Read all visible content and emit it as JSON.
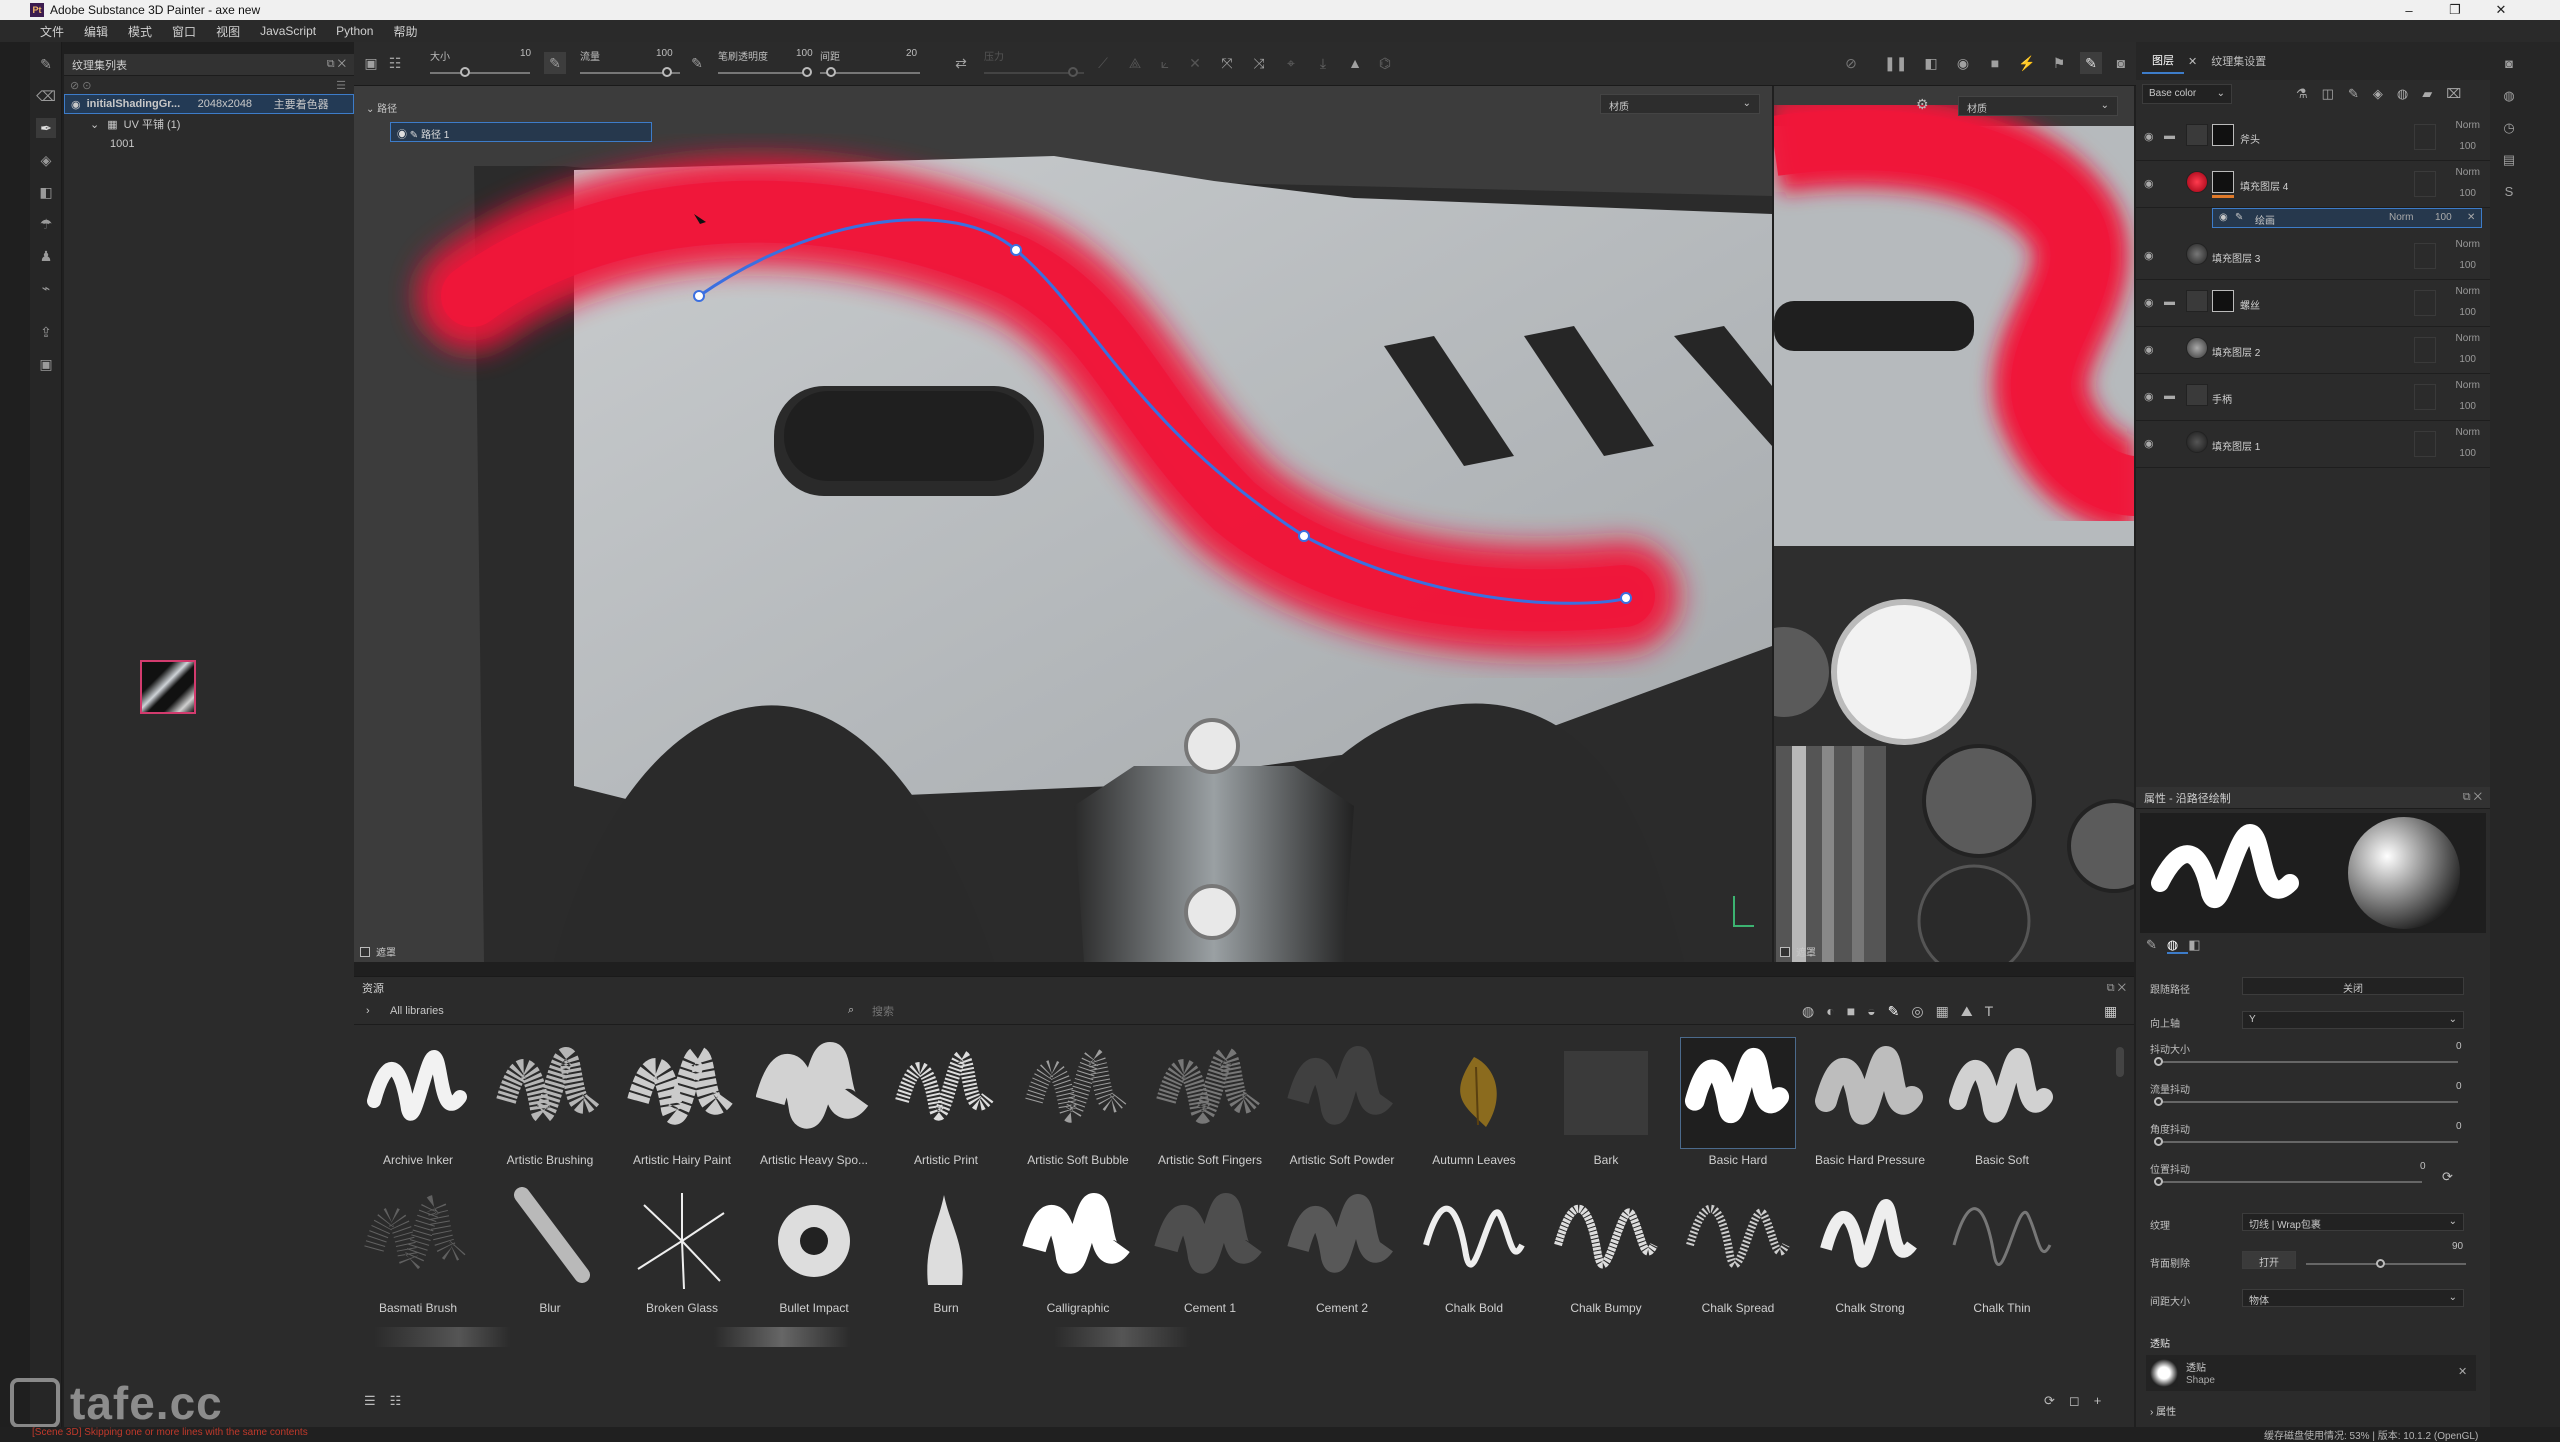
{
  "window": {
    "title": "Adobe Substance 3D Painter - axe new",
    "app_badge": "Pt",
    "controls": [
      "–",
      "❐",
      "✕"
    ]
  },
  "menu": [
    "文件",
    "编辑",
    "模式",
    "窗口",
    "视图",
    "JavaScript",
    "Python",
    "帮助"
  ],
  "texture_set_list": {
    "title": "纹理集列表",
    "set_name": "initialShadingGr...",
    "resolution": "2048x2048",
    "shader": "主要着色器",
    "uv_label": "UV 平铺 (1)",
    "tile": "1001"
  },
  "toolbar": {
    "size_label": "大小",
    "size_value": "10",
    "flow_label": "流量",
    "flow_value": "100",
    "opacity_label": "笔刷透明度",
    "opacity_value": "100",
    "spacing_label": "间距",
    "spacing_value": "20",
    "pressure_label": "压力"
  },
  "viewport3d": {
    "path_section": "路径",
    "path_item": "路径 1",
    "material_dropdown": "材质",
    "mask_label": "遮罩"
  },
  "viewport2d": {
    "material_dropdown": "材质",
    "mask_label": "遮罩"
  },
  "layers": {
    "tabs": [
      "图层",
      "纹理集设置"
    ],
    "channel": "Base color",
    "rows": [
      {
        "name": "斧头",
        "blend": "Norm",
        "opacity": "100",
        "folder": true
      },
      {
        "name": "填充图层 4",
        "blend": "Norm",
        "opacity": "100",
        "folder": false,
        "color": "#d9132f"
      },
      {
        "name": "绘画",
        "blend": "Norm",
        "opacity": "100",
        "sub": true
      },
      {
        "name": "填充图层 3",
        "blend": "Norm",
        "opacity": "100",
        "folder": false
      },
      {
        "name": "螺丝",
        "blend": "Norm",
        "opacity": "100",
        "folder": true
      },
      {
        "name": "填充图层 2",
        "blend": "Norm",
        "opacity": "100",
        "folder": false
      },
      {
        "name": "手柄",
        "blend": "Norm",
        "opacity": "100",
        "folder": true
      },
      {
        "name": "填充图层 1",
        "blend": "Norm",
        "opacity": "100",
        "folder": false
      }
    ]
  },
  "properties": {
    "title": "属性 - 沿路径绘制",
    "fields": [
      {
        "label": "跟随路径",
        "value": "关闭"
      },
      {
        "label": "向上轴",
        "value": "Y"
      },
      {
        "label": "抖动大小",
        "value": "0"
      },
      {
        "label": "流量抖动",
        "value": "0"
      },
      {
        "label": "角度抖动",
        "value": "0"
      },
      {
        "label": "位置抖动",
        "value": "0"
      },
      {
        "label": "纹理",
        "value": "切线 | Wrap包裹"
      },
      {
        "label": "背面剔除",
        "value": "打开",
        "num": "90"
      },
      {
        "label": "间距大小",
        "value": "物体"
      }
    ],
    "section_stencil": "透贴",
    "stencil_name": "透贴",
    "stencil_sub": "Shape",
    "section_attr": "属性"
  },
  "assets": {
    "title": "资源",
    "library": "All libraries",
    "search_placeholder": "搜索",
    "brushes_row1": [
      "Archive Inker",
      "Artistic Brushing",
      "Artistic Hairy Paint",
      "Artistic Heavy Spo...",
      "Artistic Print",
      "Artistic Soft Bubble",
      "Artistic Soft Fingers",
      "Artistic Soft Powder",
      "Autumn Leaves",
      "Bark",
      "Basic Hard",
      "Basic Hard Pressure",
      "Basic Soft"
    ],
    "brushes_row2": [
      "Basmati Brush",
      "Blur",
      "Broken Glass",
      "Bullet Impact",
      "Burn",
      "Calligraphic",
      "Cement 1",
      "Cement 2",
      "Chalk Bold",
      "Chalk Bumpy",
      "Chalk Spread",
      "Chalk Strong",
      "Chalk Thin"
    ],
    "selected": "Basic Hard"
  },
  "status": {
    "left": "[Scene 3D] Skipping one or more lines with the same contents",
    "right": "缓存磁盘使用情况:  53% | 版本: 10.1.2 (OpenGL)"
  },
  "watermark": "tafe.cc",
  "colors": {
    "accent": "#3d7cc9",
    "paint": "#f0163a",
    "path": "#3b6fe0"
  }
}
